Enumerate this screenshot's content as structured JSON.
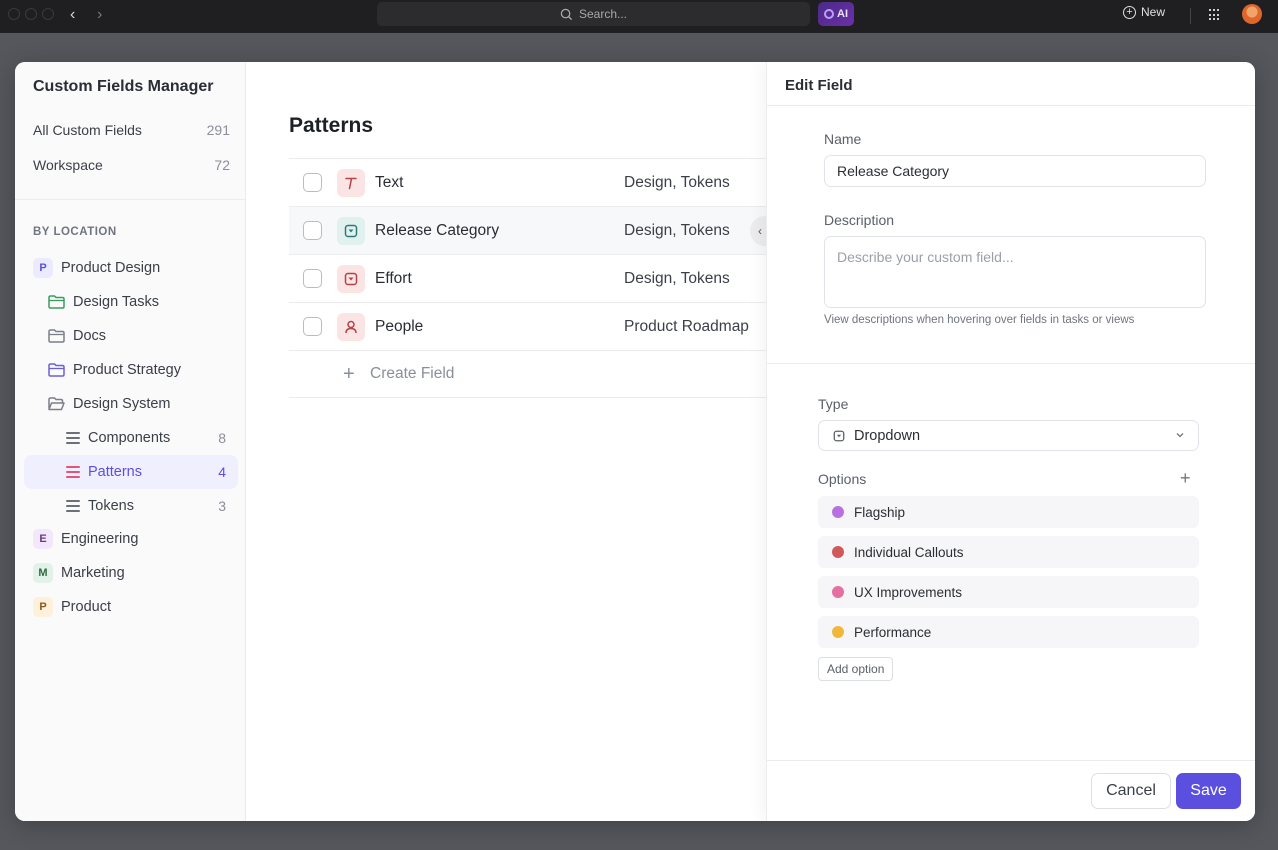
{
  "topbar": {
    "search_placeholder": "Search...",
    "ai_label": "AI",
    "new_label": "New",
    "icons": [
      "traffic-lights",
      "back-arrow-icon",
      "forward-arrow-icon",
      "search-icon",
      "ai-icon",
      "plus-circle-icon",
      "apps-grid-icon",
      "user-avatar"
    ]
  },
  "sidebar": {
    "title": "Custom Fields Manager",
    "summary": [
      {
        "label": "All Custom Fields",
        "count": "291"
      },
      {
        "label": "Workspace",
        "count": "72"
      }
    ],
    "section_label": "BY LOCATION",
    "tree": [
      {
        "type": "space",
        "badge": "P",
        "label": "Product Design",
        "badge_bg": "#ecebfd",
        "badge_color": "#5b4fe0"
      },
      {
        "type": "folder",
        "label": "Design Tasks",
        "color": "#3a9b5c"
      },
      {
        "type": "folder",
        "label": "Docs",
        "color": "#7a7f88"
      },
      {
        "type": "folder",
        "label": "Product Strategy",
        "color": "#6a5fd8"
      },
      {
        "type": "folder-open",
        "label": "Design System",
        "color": "#7a7f88"
      },
      {
        "type": "list",
        "label": "Components",
        "count": "8"
      },
      {
        "type": "list",
        "label": "Patterns",
        "count": "4",
        "active": true
      },
      {
        "type": "list",
        "label": "Tokens",
        "count": "3"
      },
      {
        "type": "space",
        "badge": "E",
        "label": "Engineering",
        "badge_bg": "#f3e8fb",
        "badge_color": "#6b3a8a"
      },
      {
        "type": "space",
        "badge": "M",
        "label": "Marketing",
        "badge_bg": "#e3f2e8",
        "badge_color": "#2f6b45"
      },
      {
        "type": "space",
        "badge": "P",
        "label": "Product",
        "badge_bg": "#fdf1dc",
        "badge_color": "#8a5a1a"
      }
    ]
  },
  "main": {
    "title": "Patterns",
    "rows": [
      {
        "icon": "text-icon",
        "name": "Text",
        "location": "Design, Tokens",
        "badge_bg": "#fbe4e4",
        "icon_color": "#b2434a"
      },
      {
        "icon": "dropdown-icon",
        "name": "Release Category",
        "location": "Design, Tokens",
        "badge_bg": "#e0f1f0",
        "icon_color": "#2f7a74",
        "highlight": true
      },
      {
        "icon": "dropdown-icon",
        "name": "Effort",
        "location": "Design, Tokens",
        "badge_bg": "#fbe4e4",
        "icon_color": "#b2434a"
      },
      {
        "icon": "person-icon",
        "name": "People",
        "location": "Product Roadmap",
        "badge_bg": "#fbe4e4",
        "icon_color": "#b2434a"
      }
    ],
    "create_label": "Create Field"
  },
  "panel": {
    "title": "Edit Field",
    "name_label": "Name",
    "name_value": "Release Category",
    "description_label": "Description",
    "description_placeholder": "Describe your custom field...",
    "description_hint": "View descriptions when hovering over fields in tasks or views",
    "type_label": "Type",
    "type_value": "Dropdown",
    "options_label": "Options",
    "options": [
      {
        "label": "Flagship",
        "color": "#b86fe0"
      },
      {
        "label": "Individual Callouts",
        "color": "#d0585a"
      },
      {
        "label": "UX Improvements",
        "color": "#e46fa0"
      },
      {
        "label": "Performance",
        "color": "#f0b83a"
      }
    ],
    "add_option_label": "Add option",
    "cancel_label": "Cancel",
    "save_label": "Save"
  },
  "colors": {
    "accent": "#5b4fe0",
    "active_bg": "#f0effd",
    "patterns_icon": "#e0567a"
  }
}
